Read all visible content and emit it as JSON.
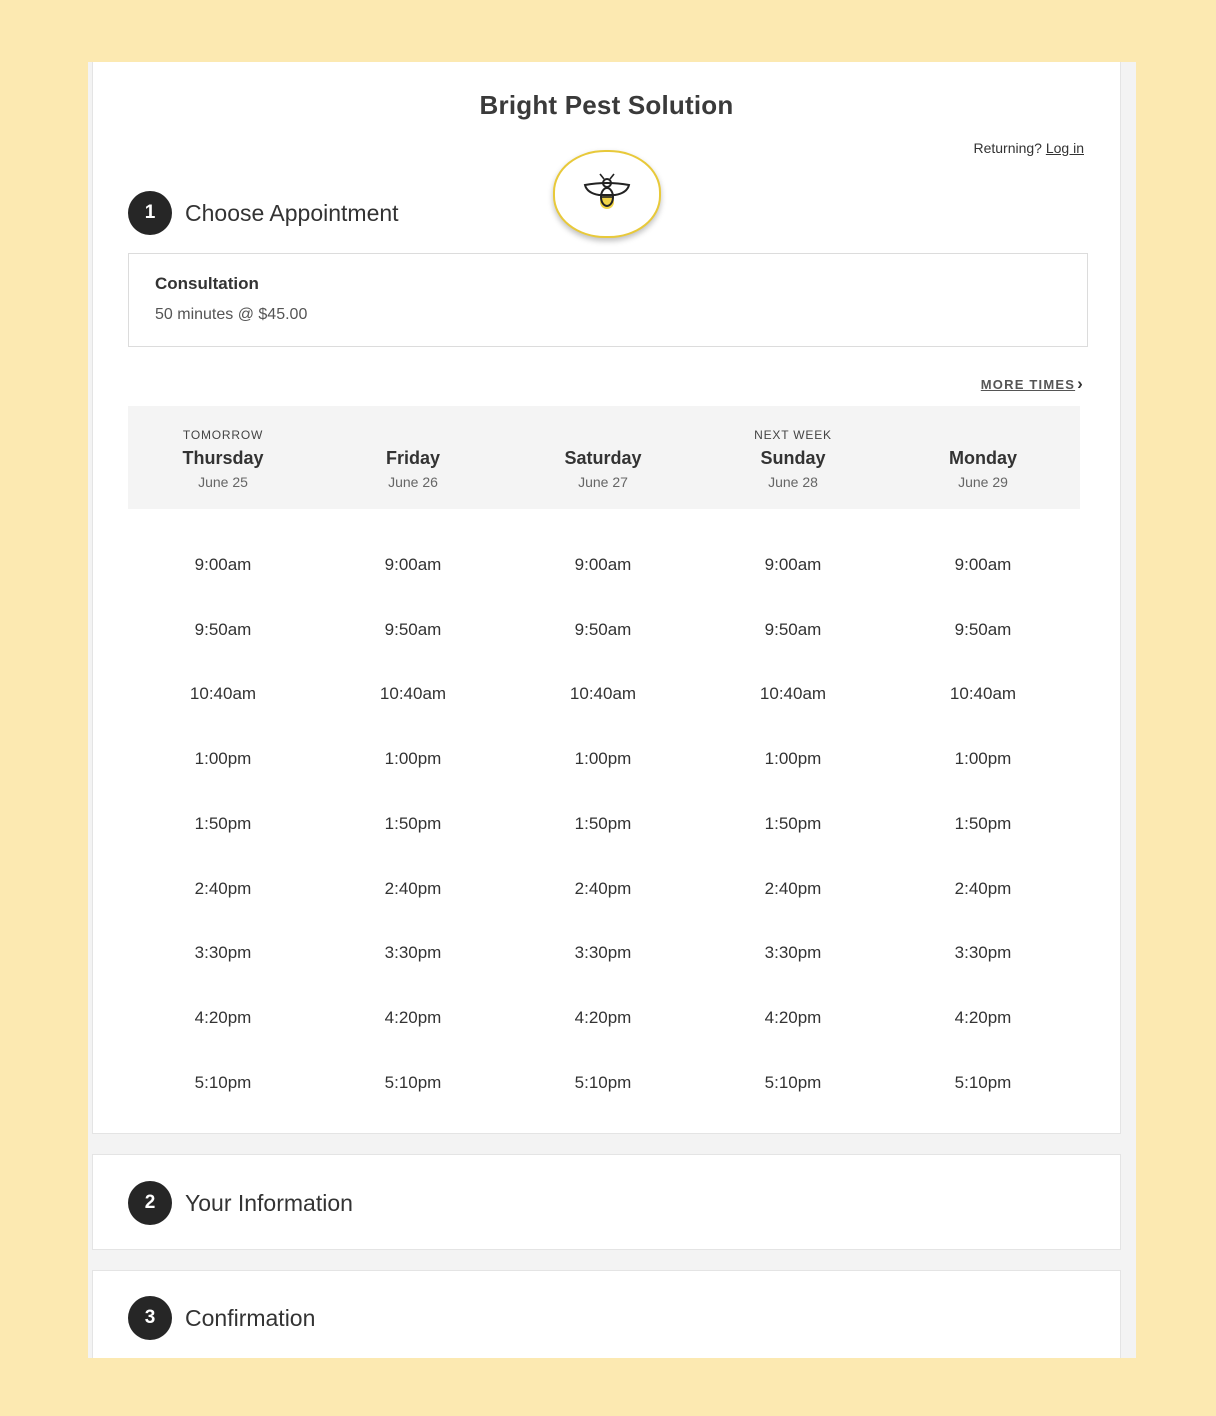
{
  "business_name": "Bright Pest Solution",
  "returning": {
    "prefix": "Returning? ",
    "login_label": "Log in"
  },
  "logo_icon": "bee-icon",
  "colors": {
    "page_bg": "#fce9b1",
    "accent": "#e8c93a"
  },
  "steps": [
    {
      "number": "1",
      "label": "Choose Appointment"
    },
    {
      "number": "2",
      "label": "Your Information"
    },
    {
      "number": "3",
      "label": "Confirmation"
    }
  ],
  "service": {
    "name": "Consultation",
    "detail": "50 minutes @ $45.00"
  },
  "more_times_label": "MORE TIMES",
  "days": [
    {
      "sup": "TOMORROW",
      "name": "Thursday",
      "date": "June 25"
    },
    {
      "sup": "",
      "name": "Friday",
      "date": "June 26"
    },
    {
      "sup": "",
      "name": "Saturday",
      "date": "June 27"
    },
    {
      "sup": "NEXT WEEK",
      "name": "Sunday",
      "date": "June 28"
    },
    {
      "sup": "",
      "name": "Monday",
      "date": "June 29"
    }
  ],
  "times": [
    "9:00am",
    "9:50am",
    "10:40am",
    "1:00pm",
    "1:50pm",
    "2:40pm",
    "3:30pm",
    "4:20pm",
    "5:10pm"
  ]
}
